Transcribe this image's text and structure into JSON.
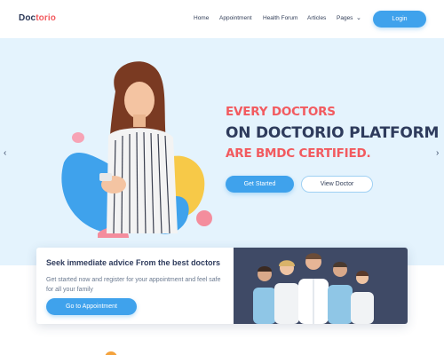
{
  "brand": {
    "part1": "Doc",
    "part2": "torio"
  },
  "nav": {
    "items": [
      "Home",
      "Appointment",
      "Health Forum",
      "Articles",
      "Pages"
    ],
    "login": "Login"
  },
  "hero": {
    "line1": "EVERY DOCTORS",
    "line2": "ON DOCTORIO PLATFORM",
    "line3": "ARE BMDC CERTIFIED.",
    "primary_button": "Get Started",
    "secondary_button": "View Doctor",
    "prev_icon": "chevron-left-icon",
    "next_icon": "chevron-right-icon"
  },
  "info_card": {
    "title": "Seek immediate advice From the best doctors",
    "text": "Get started now and register for your appointment and feel safe for all your family",
    "button": "Go to Appointment"
  },
  "colors": {
    "accent_blue": "#3fa2ec",
    "accent_red": "#f25a5f",
    "navy": "#2e3b5c",
    "hero_bg": "#e4f3fd"
  }
}
